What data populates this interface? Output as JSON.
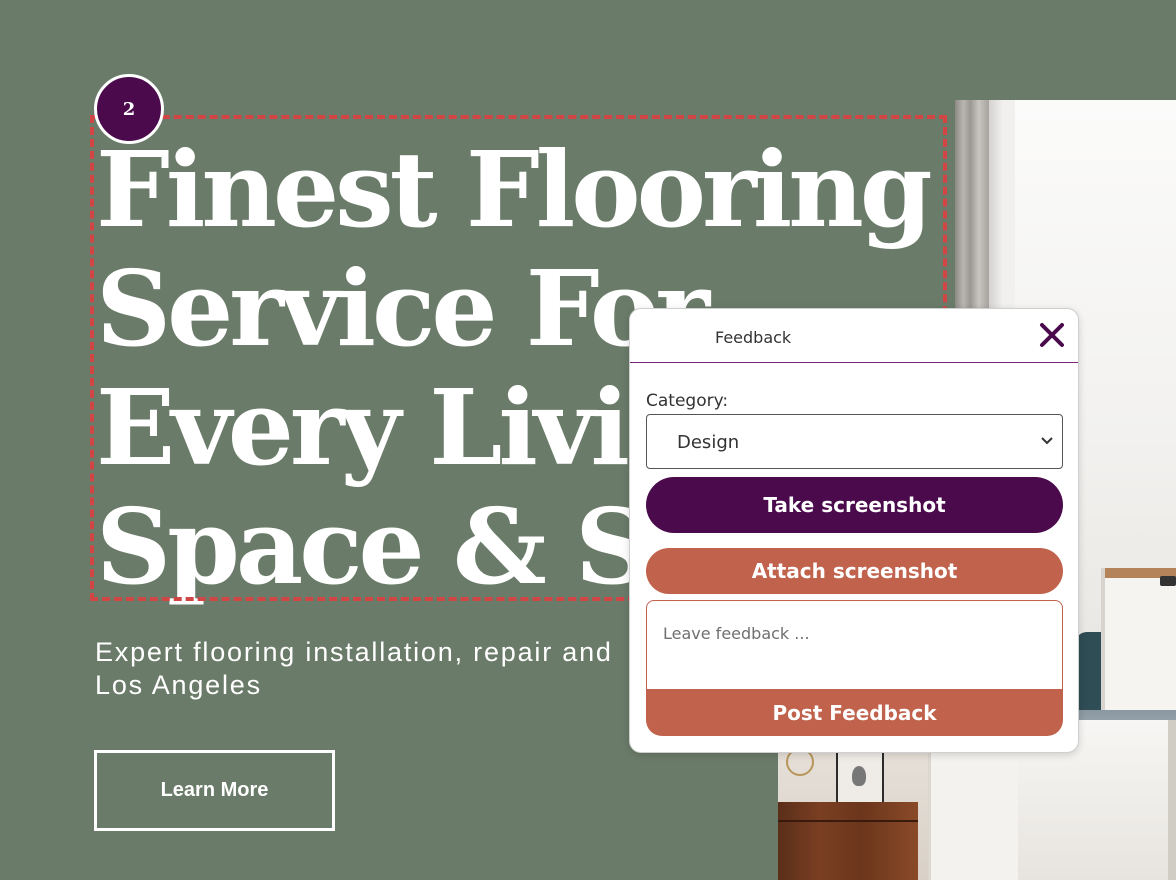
{
  "hero": {
    "step_number": "2",
    "title_lines": [
      "Finest Flooring",
      "Service For",
      "Every Living",
      "Space & Style"
    ],
    "subtitle_lines": [
      "Expert flooring installation, repair and",
      "Los Angeles"
    ],
    "learn_more_label": "Learn More"
  },
  "feedback": {
    "title": "Feedback",
    "category_label": "Category:",
    "category_value": "Design",
    "take_screenshot_label": "Take screenshot",
    "attach_screenshot_label": "Attach screenshot",
    "feedback_placeholder": "Leave feedback ...",
    "post_label": "Post Feedback"
  },
  "colors": {
    "background": "#6b7b69",
    "accent_purple": "#4a0a4c",
    "accent_terracotta": "#c0624c",
    "highlight_dashed": "#d14545"
  },
  "icons": {
    "close": "close-icon",
    "chevron": "chevron-down-icon"
  }
}
